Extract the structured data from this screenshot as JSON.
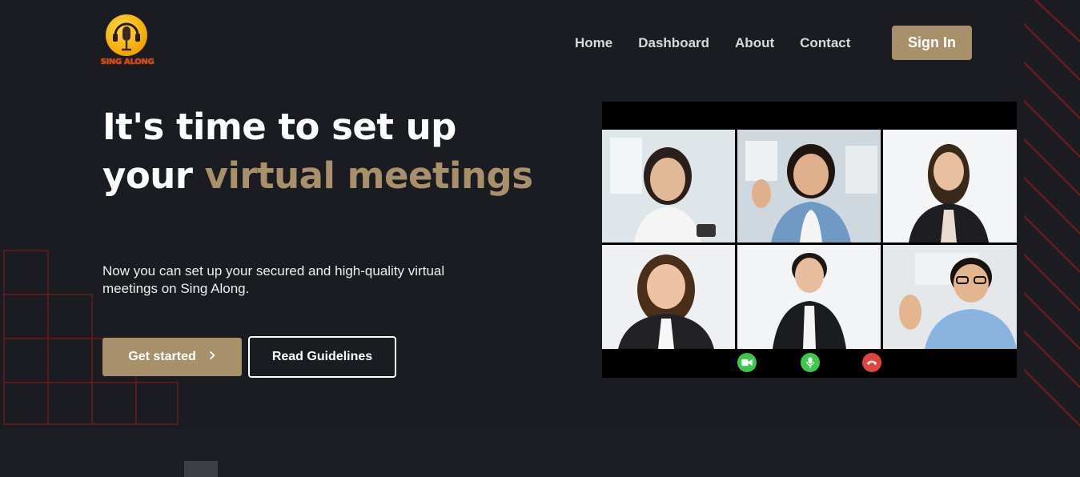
{
  "brand": {
    "logo_text": "SING ALONG"
  },
  "nav": {
    "items": [
      {
        "label": "Home"
      },
      {
        "label": "Dashboard"
      },
      {
        "label": "About"
      },
      {
        "label": "Contact"
      }
    ],
    "sign_in": "Sign In"
  },
  "hero": {
    "headline_part1": "It's time to set up your ",
    "headline_accent": "virtual meetings",
    "subtext": "Now you can set up your secured and high-quality virtual meetings on Sing Along.",
    "cta_primary": "Get started",
    "cta_secondary": "Read Guidelines"
  },
  "colors": {
    "background": "#1b1c21",
    "accent": "#a8916a",
    "deco_red": "#8b1a1a",
    "call_green": "#3cc94b",
    "call_red": "#e0453d"
  },
  "icons": {
    "chevron": "chevron-right-icon",
    "controls": [
      "video-camera-icon",
      "microphone-icon",
      "end-call-icon"
    ]
  }
}
